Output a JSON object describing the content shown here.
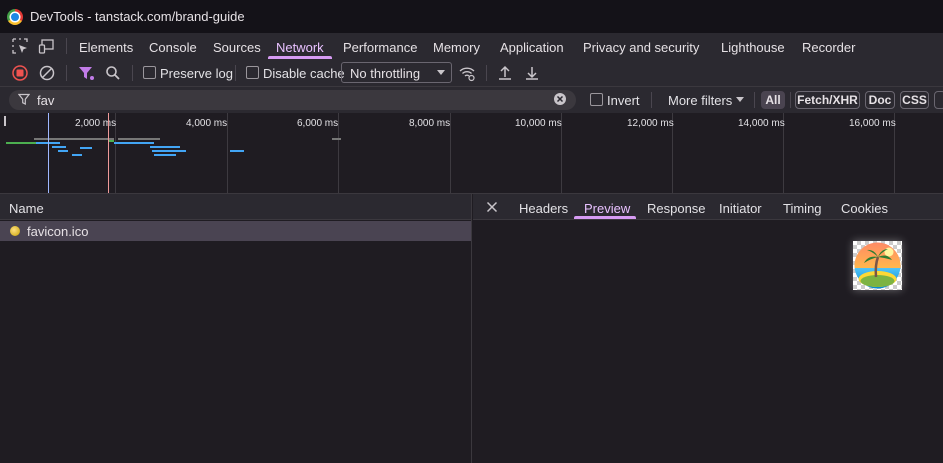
{
  "window": {
    "title": "DevTools - tanstack.com/brand-guide"
  },
  "panel_tabs": [
    "Elements",
    "Console",
    "Sources",
    "Network",
    "Performance",
    "Memory",
    "Application",
    "Privacy and security",
    "Lighthouse",
    "Recorder"
  ],
  "active_panel": "Network",
  "toolbar": {
    "preserve_log": "Preserve log",
    "disable_cache": "Disable cache",
    "throttling": "No throttling"
  },
  "filter": {
    "value": "fav",
    "invert": "Invert",
    "more_filters": "More filters",
    "types": [
      "All",
      "Fetch/XHR",
      "Doc",
      "CSS"
    ]
  },
  "timeline": {
    "ticks": [
      "2,000 ms",
      "4,000 ms",
      "6,000 ms",
      "8,000 ms",
      "10,000 ms",
      "12,000 ms",
      "14,000 ms",
      "16,000 ms"
    ]
  },
  "requests": {
    "column_name": "Name",
    "rows": [
      {
        "name": "favicon.ico"
      }
    ]
  },
  "detail_tabs": [
    "Headers",
    "Preview",
    "Response",
    "Initiator",
    "Timing",
    "Cookies"
  ],
  "active_detail_tab": "Preview",
  "colors": {
    "accent": "#d69bf3",
    "record": "#ef5350",
    "funnel": "#c27ce8",
    "selected_row": "#4a4452"
  }
}
